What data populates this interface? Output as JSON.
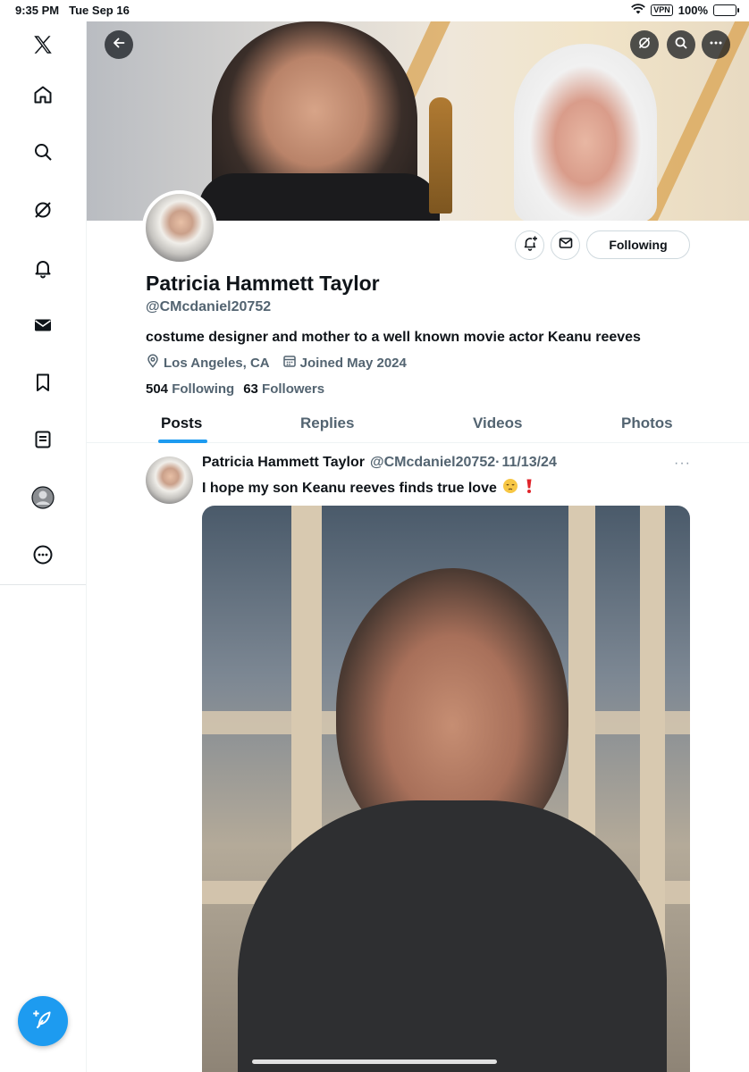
{
  "status_bar": {
    "time": "9:35 PM",
    "date": "Tue Sep 16",
    "vpn": "VPN",
    "battery": "100%"
  },
  "sidebar": {
    "items": [
      {
        "icon": "x-logo-icon"
      },
      {
        "icon": "home-icon"
      },
      {
        "icon": "search-icon"
      },
      {
        "icon": "grok-icon"
      },
      {
        "icon": "bell-icon"
      },
      {
        "icon": "mail-icon"
      },
      {
        "icon": "bookmark-icon"
      },
      {
        "icon": "lists-icon"
      },
      {
        "icon": "profile-icon"
      },
      {
        "icon": "more-icon"
      }
    ],
    "compose_icon": "compose-feather-icon"
  },
  "profile": {
    "display_name": "Patricia Hammett Taylor",
    "handle": "@CMcdaniel20752",
    "bio": "costume designer and mother to a well known movie actor Keanu reeves",
    "location": "Los Angeles, CA",
    "joined": "Joined May 2024",
    "following_count": "504",
    "following_label": "Following",
    "followers_count": "63",
    "followers_label": "Followers",
    "follow_button": "Following"
  },
  "tabs": [
    {
      "label": "Posts",
      "active": true
    },
    {
      "label": "Replies",
      "active": false
    },
    {
      "label": "Videos",
      "active": false
    },
    {
      "label": "Photos",
      "active": false
    }
  ],
  "post": {
    "author": "Patricia Hammett Taylor",
    "handle": "@CMcdaniel20752",
    "separator": "·",
    "date": "11/13/24",
    "text": "I hope my son Keanu reeves finds true love",
    "emojis": [
      "pensive-face",
      "red-exclamation"
    ],
    "more": "···"
  },
  "colors": {
    "accent": "#1d9bf0",
    "text": "#0f1419",
    "secondary": "#536471"
  }
}
